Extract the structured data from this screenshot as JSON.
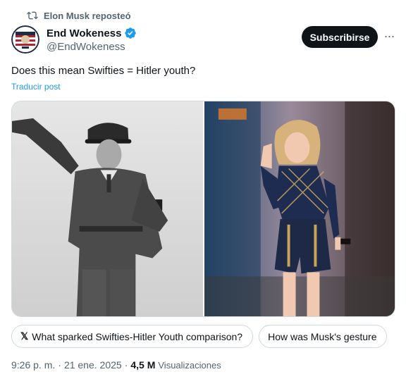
{
  "repost": {
    "label": "Elon Musk reposteó",
    "icon": "repost-icon"
  },
  "author": {
    "name": "End Wokeness",
    "handle": "@EndWokeness",
    "verified": true,
    "verified_color": "#1d9bf0"
  },
  "subscribe_label": "Subscribirse",
  "more_label": "···",
  "tweet": {
    "text": "Does this mean Swifties = Hitler youth?",
    "translate_label": "Traducir post"
  },
  "chips": [
    {
      "icon": "grok-icon",
      "glyph": "𝕏",
      "label": "What sparked Swifties-Hitler Youth comparison?"
    },
    {
      "label": "How was Musk's gesture"
    }
  ],
  "meta": {
    "time": "9:26 p. m.",
    "sep1": "·",
    "date": "21 ene. 2025",
    "sep2": "·",
    "views_count": "4,5 M",
    "views_label": "Visualizaciones"
  },
  "colors": {
    "accent": "#1d9bf0",
    "text": "#0f1419",
    "muted": "#536471",
    "border": "#cfd9de"
  }
}
